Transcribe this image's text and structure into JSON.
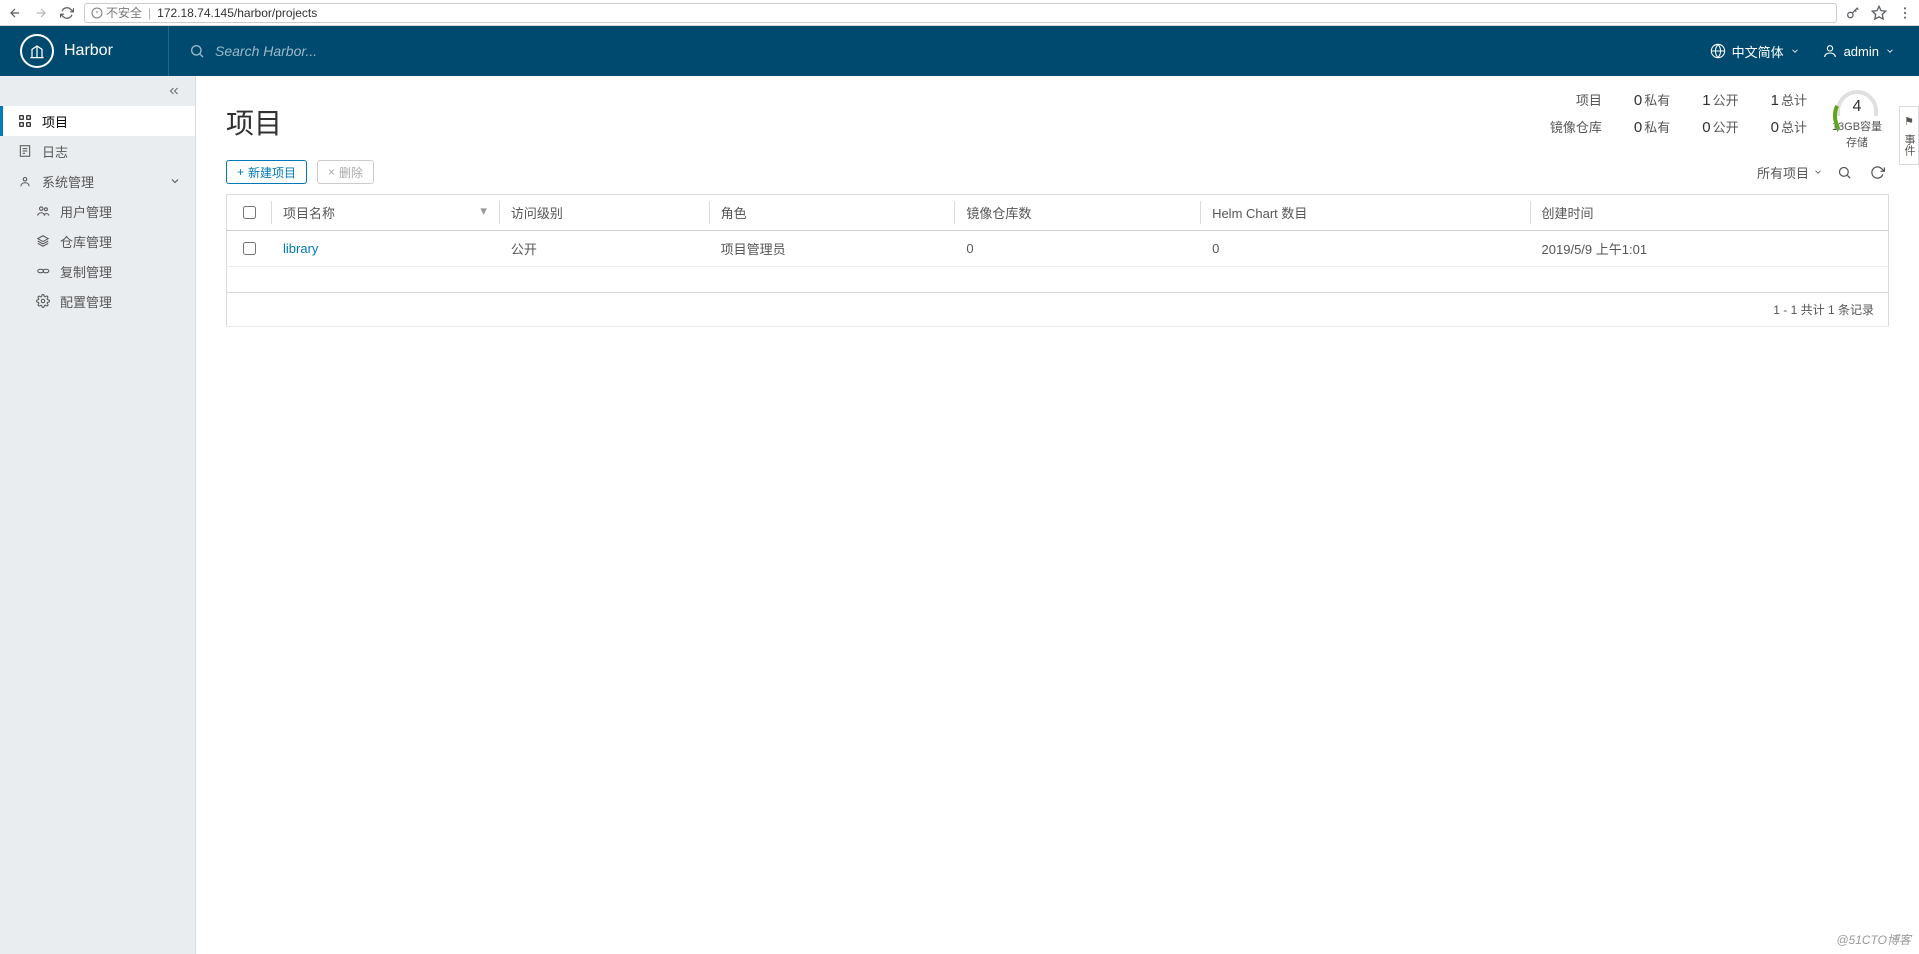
{
  "browser": {
    "insecure_label": "不安全",
    "url": "172.18.74.145/harbor/projects"
  },
  "app_name": "Harbor",
  "search_placeholder": "Search Harbor...",
  "lang_label": "中文简体",
  "user_label": "admin",
  "sidebar": {
    "projects": "项目",
    "logs": "日志",
    "admin": "系统管理",
    "users": "用户管理",
    "repos": "仓库管理",
    "replication": "复制管理",
    "config": "配置管理"
  },
  "page_title": "项目",
  "summary": {
    "row1_label": "项目",
    "row2_label": "镜像仓库",
    "private_n": "0",
    "private_lbl": "私有",
    "public_n": "1",
    "public_lbl": "公开",
    "total_n": "1",
    "total_lbl": "总计",
    "r_private_n": "0",
    "r_public_n": "0",
    "r_total_n": "0"
  },
  "storage": {
    "number": "4",
    "line1": "13GB容量",
    "line2": "存储"
  },
  "buttons": {
    "new": "新建项目",
    "delete": "删除"
  },
  "filter_label": "所有项目",
  "columns": {
    "name": "项目名称",
    "access": "访问级别",
    "role": "角色",
    "repo_count": "镜像仓库数",
    "chart_count": "Helm Chart 数目",
    "created": "创建时间"
  },
  "rows": [
    {
      "name": "library",
      "access": "公开",
      "role": "项目管理员",
      "repo": "0",
      "chart": "0",
      "created": "2019/5/9 上午1:01"
    }
  ],
  "pagination": "1 - 1 共计 1 条记录",
  "event_tab": "事件",
  "watermark": "@51CTO博客"
}
